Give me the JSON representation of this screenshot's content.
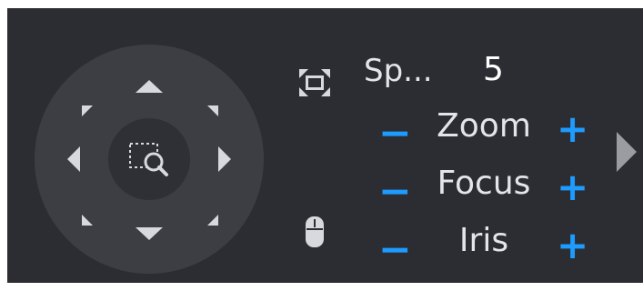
{
  "ptz": {
    "speed_label": "Sp...",
    "speed_value": "5",
    "zoom": {
      "label": "Zoom",
      "minus": "−",
      "plus": "+"
    },
    "focus": {
      "label": "Focus",
      "minus": "−",
      "plus": "+"
    },
    "iris": {
      "label": "Iris",
      "minus": "−",
      "plus": "+"
    }
  },
  "icons": {
    "fullscreen": "fullscreen-icon",
    "mouse": "mouse-icon",
    "expand": "chevron-right-icon",
    "center": "zoom-region-icon"
  },
  "colors": {
    "panel_bg": "#2b2d33",
    "dpad_bg": "#3c3e44",
    "accent": "#1e9bff",
    "text": "#e4e5e8"
  }
}
